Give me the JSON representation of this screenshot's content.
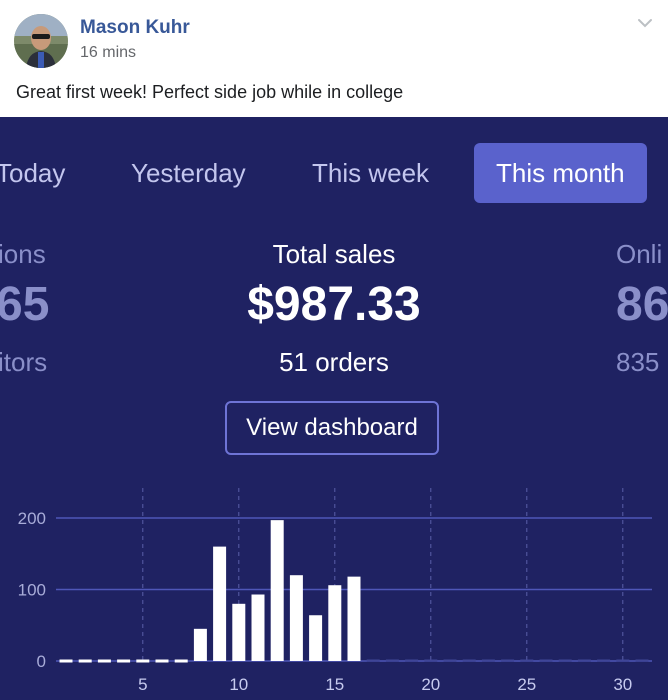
{
  "post": {
    "author": "Mason Kuhr",
    "time": "16 mins",
    "text": "Great first week! Perfect side job while in college"
  },
  "colors": {
    "card_bg": "#1f2262",
    "active_tab": "#5a62cc",
    "author_link": "#385898",
    "bars": "#ffffff"
  },
  "tabs": [
    {
      "label": "Today",
      "active": false
    },
    {
      "label": "Yesterday",
      "active": false
    },
    {
      "label": "This week",
      "active": false
    },
    {
      "label": "This month",
      "active": true
    }
  ],
  "stats": {
    "left": {
      "label": "ions",
      "value": "65",
      "sub": "itors"
    },
    "center": {
      "label": "Total sales",
      "value": "$987.33",
      "sub": "51 orders"
    },
    "right": {
      "label": "Onli",
      "value": "86",
      "sub": "835"
    }
  },
  "dashboard_button": "View dashboard",
  "icons": {
    "avatar": "user-photo",
    "menu": "chevron-down-icon"
  },
  "chart_data": {
    "type": "bar",
    "x": [
      1,
      2,
      3,
      4,
      5,
      6,
      7,
      8,
      9,
      10,
      11,
      12,
      13,
      14,
      15,
      16,
      17,
      18,
      19,
      20,
      21,
      22,
      23,
      24,
      25,
      26,
      27,
      28,
      29,
      30,
      31
    ],
    "values": [
      0,
      0,
      0,
      0,
      0,
      0,
      0,
      45,
      160,
      80,
      93,
      197,
      120,
      64,
      106,
      118,
      0,
      0,
      0,
      0,
      0,
      0,
      0,
      0,
      0,
      0,
      0,
      0,
      0,
      0,
      0
    ],
    "x_ticks": [
      5,
      10,
      15,
      20,
      25,
      30
    ],
    "y_ticks": [
      0,
      100,
      200
    ],
    "ylim": [
      0,
      200
    ],
    "grid": true
  }
}
